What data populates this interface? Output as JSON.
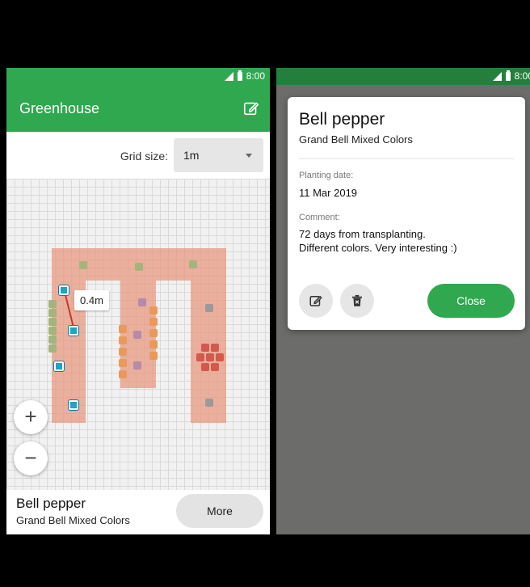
{
  "status_bar": {
    "time": "8:00"
  },
  "app_bar": {
    "title": "Greenhouse"
  },
  "grid_size": {
    "label": "Grid size:",
    "value": "1m"
  },
  "map": {
    "measure_label": "0.4m",
    "zoom_in": "+",
    "zoom_out": "−",
    "colors": {
      "bed": "#e7967d",
      "selected_plant": "#18a6c9",
      "green_plant": "#a5b47c",
      "purple_plant": "#b78aa8",
      "orange_plant": "#e99a5a",
      "red_plant": "#d4594d",
      "grey_plant": "#9a9a9a"
    }
  },
  "selected_plant": {
    "name": "Bell pepper",
    "variety": "Grand Bell Mixed Colors",
    "more_label": "More"
  },
  "dialog": {
    "title": "Bell pepper",
    "variety": "Grand Bell Mixed Colors",
    "planting_date_label": "Planting date:",
    "planting_date": "11 Mar 2019",
    "comment_label": "Comment:",
    "comment_line1": "72 days from transplanting.",
    "comment_line2": "Different colors. Very interesting :)",
    "close_label": "Close"
  },
  "theme": {
    "primary": "#2fa84f",
    "primary_dark": "#247f3c"
  }
}
